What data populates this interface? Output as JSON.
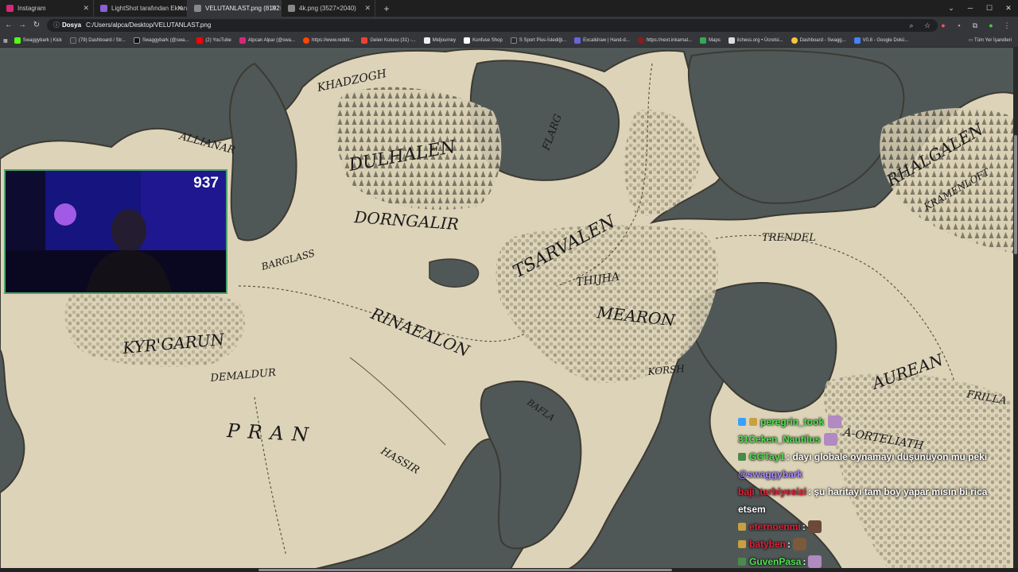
{
  "tabs": [
    {
      "label": "Instagram",
      "active": false,
      "favicon_color": "#d6287a"
    },
    {
      "label": "LightShot tarafından Ekran Gö",
      "active": false,
      "favicon_color": "#8a60d8"
    },
    {
      "label": "VELUTANLAST.png (8192×7193",
      "active": true,
      "favicon_color": "#888888"
    },
    {
      "label": "4k.png (3527×2040)",
      "active": false,
      "favicon_color": "#888888"
    }
  ],
  "address": {
    "protocol": "Dosya",
    "url": "C:/Users/alpca/Desktop/VELUTANLAST.png"
  },
  "bookmarks": [
    {
      "label": "Swaggybark | Kick",
      "color": "#53fc18"
    },
    {
      "label": "(79) Dashboard / Str...",
      "color": "#3a3a3a"
    },
    {
      "label": "Swaggybark (@swa...",
      "color": "#111111"
    },
    {
      "label": "(2) YouTube",
      "color": "#ff0000"
    },
    {
      "label": "Alpcan Alpar (@swa...",
      "color": "#d6287a"
    },
    {
      "label": "https://www.reddit...",
      "color": "#ff4500"
    },
    {
      "label": "Gelen Kutusu (31) -...",
      "color": "#ea4335"
    },
    {
      "label": "Midjourney",
      "color": "#eeeeee"
    },
    {
      "label": "Konfuse Shop",
      "color": "#ffffff"
    },
    {
      "label": "S Sport Plus-İstediği...",
      "color": "#2a2a2a"
    },
    {
      "label": "Excalidraw | Hand-d...",
      "color": "#6965db"
    },
    {
      "label": "https://next.inkarnat...",
      "color": "#8c1c1c"
    },
    {
      "label": "Maps",
      "color": "#34a853"
    },
    {
      "label": "lichess.org • Ücretsi...",
      "color": "#dddddd"
    },
    {
      "label": "Dashboard - Swagg...",
      "color": "#f5c542"
    },
    {
      "label": "V0.8 - Google Dokü...",
      "color": "#4285f4"
    }
  ],
  "bookmarks_all": "Tüm Yer İşaretleri",
  "webcam": {
    "count": "937"
  },
  "map_labels": [
    "KHADZOGH",
    "ALLIANAR",
    "DULHALEN",
    "FLARG",
    "DORNGALIR",
    "TSARVALEN",
    "RHALGALEN",
    "KRAMENLOFT",
    "BARGLASS",
    "TRENDEL",
    "THIJHA",
    "MEARON",
    "RINAEALON",
    "KYR'GARUN",
    "DEMALDUR",
    "KORSH",
    "AUREAN",
    "FRILLA",
    "PRAN",
    "BAFLA",
    "HASSIR",
    "A-ORTELIATH"
  ],
  "chat": [
    {
      "user": "peregrin_took",
      "color": "#52e352",
      "text": "",
      "emote_after": true
    },
    {
      "user": "31Ceken_Nautilus",
      "color": "#52e352",
      "text": "",
      "emote_after": true
    },
    {
      "user": "GGTay1",
      "color": "#52e352",
      "text": ": dayı globale oynamayı düşünüyon mu peki",
      "emote_after": false
    },
    {
      "user": "",
      "color": "#a88cff",
      "text": "@swaggybark",
      "emote_after": false
    },
    {
      "user": "baji_terbiyesizi",
      "color": "#e0233a",
      "text": ": şu haritayı tam boy yapar mısın bi rica",
      "emote_after": false
    },
    {
      "user": "",
      "color": "#ffffff",
      "text": "etsem",
      "emote_after": false
    },
    {
      "user": "eternoenmi",
      "color": "#e0233a",
      "text": ":",
      "emote_after": true
    },
    {
      "user": "batyben",
      "color": "#e0233a",
      "text": ":",
      "emote_after": true
    },
    {
      "user": "GuvenPasa",
      "color": "#52e352",
      "text": ":",
      "emote_after": true
    }
  ]
}
